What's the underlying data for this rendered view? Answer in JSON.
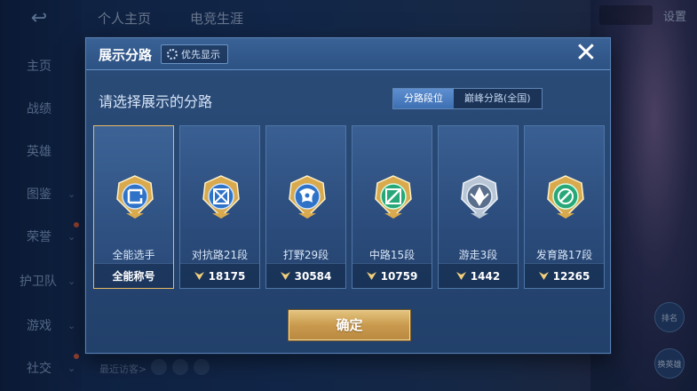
{
  "background": {
    "nav": [
      "主页",
      "战绩",
      "英雄",
      "图鉴",
      "荣誉",
      "护卫队",
      "游戏",
      "社交"
    ],
    "top_tabs": [
      "个人主页",
      "电竞生涯"
    ],
    "settings_label": "设置",
    "recent_visitors": "最近访客>",
    "right_buttons": [
      "排名",
      "换英雄"
    ]
  },
  "modal": {
    "title": "展示分路",
    "priority_label": "优先显示",
    "subtitle": "请选择展示的分路",
    "segments": [
      "分路段位",
      "巅峰分路(全国)"
    ],
    "cards": [
      {
        "name": "全能选手",
        "bottom": "全能称号",
        "selected": true
      },
      {
        "name": "对抗路21段",
        "bottom": "18175",
        "selected": false
      },
      {
        "name": "打野29段",
        "bottom": "30584",
        "selected": false
      },
      {
        "name": "中路15段",
        "bottom": "10759",
        "selected": false
      },
      {
        "name": "游走3段",
        "bottom": "1442",
        "selected": false
      },
      {
        "name": "发育路17段",
        "bottom": "12265",
        "selected": false
      }
    ],
    "confirm_label": "确定"
  },
  "colors": {
    "accent_gold": "#e8b865",
    "panel_blue": "#2b4c78",
    "emblem_gold": "#d9a94e",
    "emblem_blue": "#2f73c8",
    "emblem_green": "#28a878",
    "emblem_silver": "#b9c6d6"
  }
}
